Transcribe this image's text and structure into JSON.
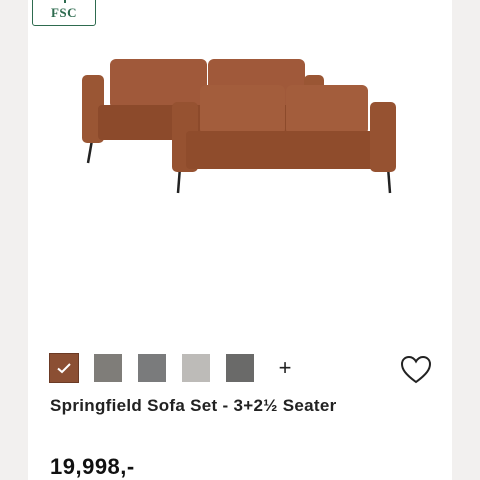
{
  "badge": {
    "text": "FSC",
    "color": "#2e6b4f",
    "icon": "fsc-tree-icon"
  },
  "product": {
    "image_alt": "Springfield Sofa Set",
    "title": "Springfield Sofa Set - 3+2½ Seater",
    "price": "19,998,-"
  },
  "swatches": [
    {
      "name": "cognac",
      "color": "#8b4f33",
      "selected": true
    },
    {
      "name": "grey",
      "color": "#7f7d79",
      "selected": false
    },
    {
      "name": "dark-grey",
      "color": "#7a7b7c",
      "selected": false
    },
    {
      "name": "light-grey",
      "color": "#bdbbb8",
      "selected": false
    },
    {
      "name": "charcoal",
      "color": "#6a6a69",
      "selected": false
    }
  ],
  "more_colors": "+",
  "icons": {
    "wishlist": "heart-icon",
    "selected": "check-icon"
  }
}
